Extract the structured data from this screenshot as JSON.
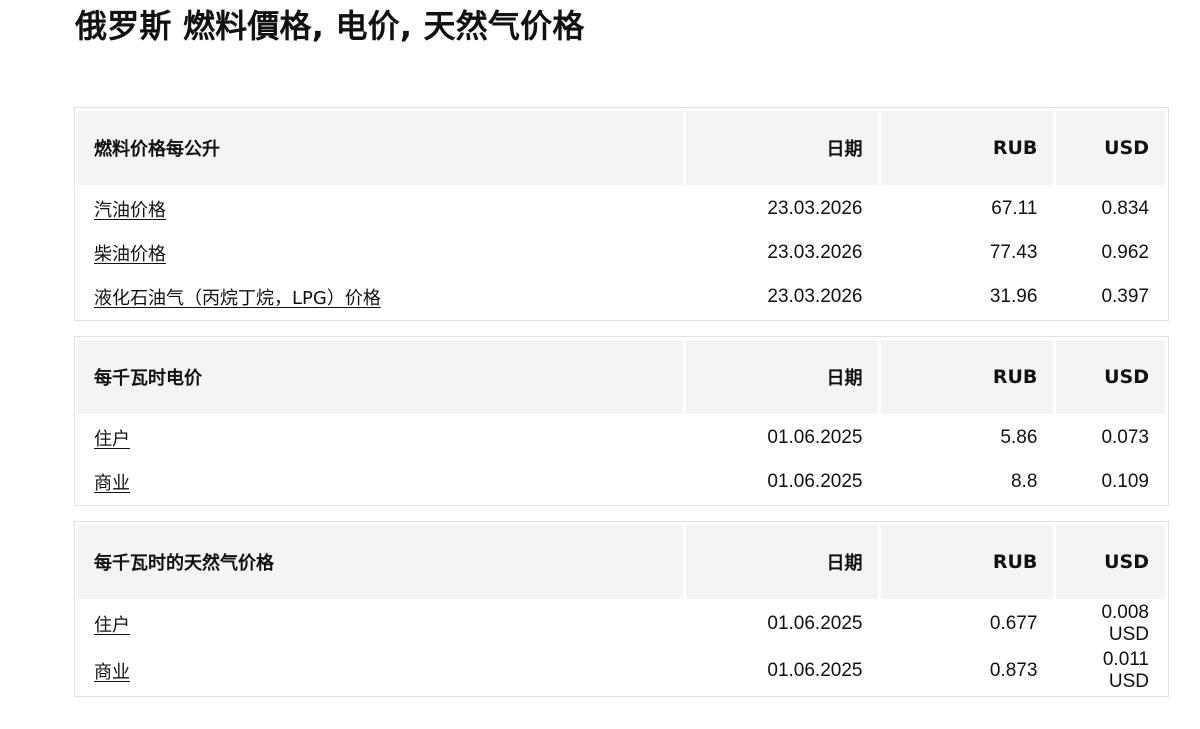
{
  "page": {
    "title": "俄罗斯 燃料價格, 电价, 天然气价格"
  },
  "fuel_table": {
    "headers": {
      "name": "燃料价格每公升",
      "date": "日期",
      "rub": "RUB",
      "usd": "USD"
    },
    "rows": [
      {
        "name": "汽油价格",
        "date": "23.03.2026",
        "rub": "67.11",
        "usd": "0.834"
      },
      {
        "name": "柴油价格",
        "date": "23.03.2026",
        "rub": "77.43",
        "usd": "0.962"
      },
      {
        "name": "液化石油气（丙烷丁烷，LPG）价格",
        "date": "23.03.2026",
        "rub": "31.96",
        "usd": "0.397"
      }
    ]
  },
  "electricity_table": {
    "headers": {
      "name": "每千瓦时电价",
      "date": "日期",
      "rub": "RUB",
      "usd": "USD"
    },
    "rows": [
      {
        "name": "住户",
        "date": "01.06.2025",
        "rub": "5.86",
        "usd": "0.073"
      },
      {
        "name": "商业",
        "date": "01.06.2025",
        "rub": "8.8",
        "usd": "0.109"
      }
    ]
  },
  "gas_table": {
    "headers": {
      "name": "每千瓦时的天然气价格",
      "date": "日期",
      "rub": "RUB",
      "usd": "USD"
    },
    "rows": [
      {
        "name": "住户",
        "date": "01.06.2025",
        "rub": "0.677",
        "usd": "0.008 USD"
      },
      {
        "name": "商业",
        "date": "01.06.2025",
        "rub": "0.873",
        "usd": "0.011 USD"
      }
    ]
  }
}
